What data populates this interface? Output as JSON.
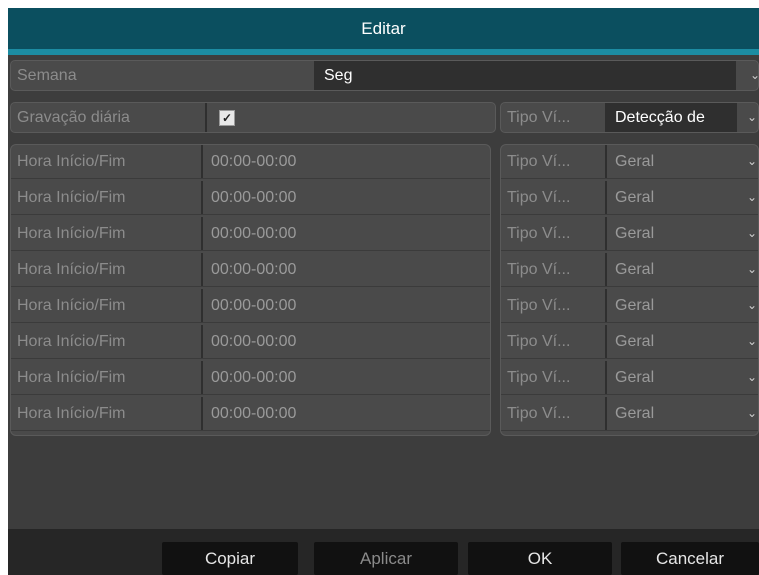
{
  "dialog": {
    "title": "Editar"
  },
  "week": {
    "label": "Semana",
    "value": "Seg"
  },
  "daily": {
    "label": "Gravação diária",
    "checked": true,
    "type_label": "Tipo Ví...",
    "type_value": "Detecção de"
  },
  "periods": [
    {
      "label": "Hora Início/Fim",
      "time": "00:00-00:00",
      "type_label": "Tipo Ví...",
      "type_value": "Geral"
    },
    {
      "label": "Hora Início/Fim",
      "time": "00:00-00:00",
      "type_label": "Tipo Ví...",
      "type_value": "Geral"
    },
    {
      "label": "Hora Início/Fim",
      "time": "00:00-00:00",
      "type_label": "Tipo Ví...",
      "type_value": "Geral"
    },
    {
      "label": "Hora Início/Fim",
      "time": "00:00-00:00",
      "type_label": "Tipo Ví...",
      "type_value": "Geral"
    },
    {
      "label": "Hora Início/Fim",
      "time": "00:00-00:00",
      "type_label": "Tipo Ví...",
      "type_value": "Geral"
    },
    {
      "label": "Hora Início/Fim",
      "time": "00:00-00:00",
      "type_label": "Tipo Ví...",
      "type_value": "Geral"
    },
    {
      "label": "Hora Início/Fim",
      "time": "00:00-00:00",
      "type_label": "Tipo Ví...",
      "type_value": "Geral"
    },
    {
      "label": "Hora Início/Fim",
      "time": "00:00-00:00",
      "type_label": "Tipo Ví...",
      "type_value": "Geral"
    }
  ],
  "buttons": {
    "copy": "Copiar",
    "apply": "Aplicar",
    "ok": "OK",
    "cancel": "Cancelar"
  },
  "icons": {
    "checkbox": "checkmark-icon",
    "dropdown": "chevron-down-icon"
  },
  "colors": {
    "title_bar": "#0b4f5f",
    "accent": "#1c8ca2",
    "background": "#3d3d3d"
  }
}
